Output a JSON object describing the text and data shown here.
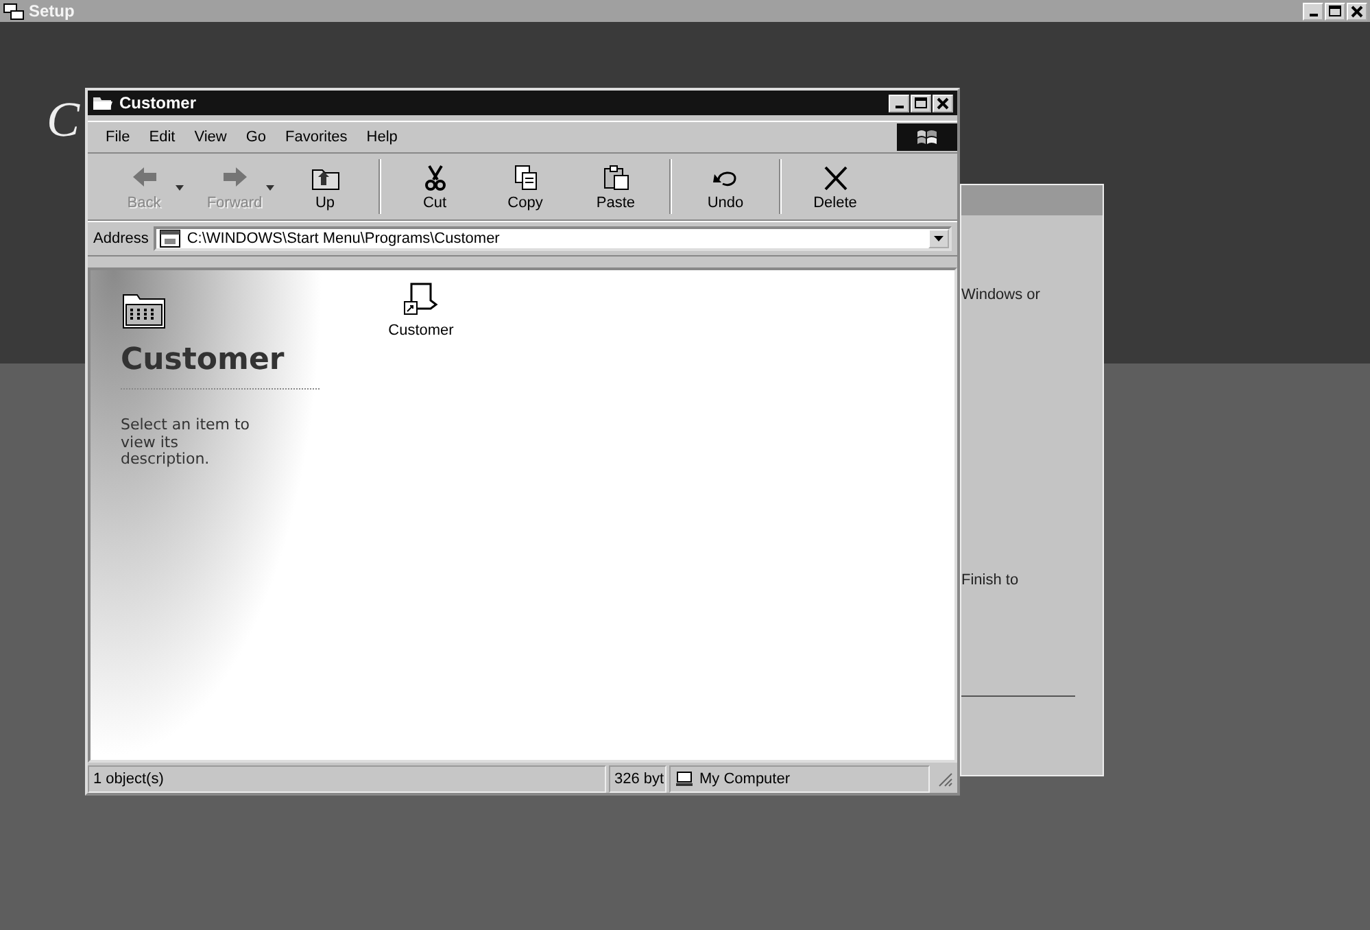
{
  "setup_window": {
    "title": "Setup",
    "heading_letter": "C"
  },
  "background_dialog": {
    "text_lines": [
      "Windows or",
      "Finish to"
    ]
  },
  "explorer": {
    "title": "Customer",
    "menu": [
      "File",
      "Edit",
      "View",
      "Go",
      "Favorites",
      "Help"
    ],
    "toolbar": [
      {
        "kind": "back",
        "label": "Back",
        "disabled": true,
        "has_menu": true
      },
      {
        "kind": "forward",
        "label": "Forward",
        "disabled": true,
        "has_menu": true
      },
      {
        "kind": "up",
        "label": "Up",
        "disabled": false,
        "has_menu": false
      },
      {
        "kind": "cut",
        "label": "Cut",
        "disabled": false,
        "has_menu": false
      },
      {
        "kind": "copy",
        "label": "Copy",
        "disabled": false,
        "has_menu": false
      },
      {
        "kind": "paste",
        "label": "Paste",
        "disabled": false,
        "has_menu": false
      },
      {
        "kind": "undo",
        "label": "Undo",
        "disabled": false,
        "has_menu": false
      },
      {
        "kind": "delete",
        "label": "Delete",
        "disabled": false,
        "has_menu": false
      }
    ],
    "address": {
      "label": "Address",
      "value": "C:\\WINDOWS\\Start Menu\\Programs\\Customer"
    },
    "folder_panel": {
      "title": "Customer",
      "description": "Select an item to view its description."
    },
    "items": [
      {
        "label": "Customer"
      }
    ],
    "status_bar": [
      "1 object(s)",
      "326 byt",
      "My Computer"
    ]
  }
}
